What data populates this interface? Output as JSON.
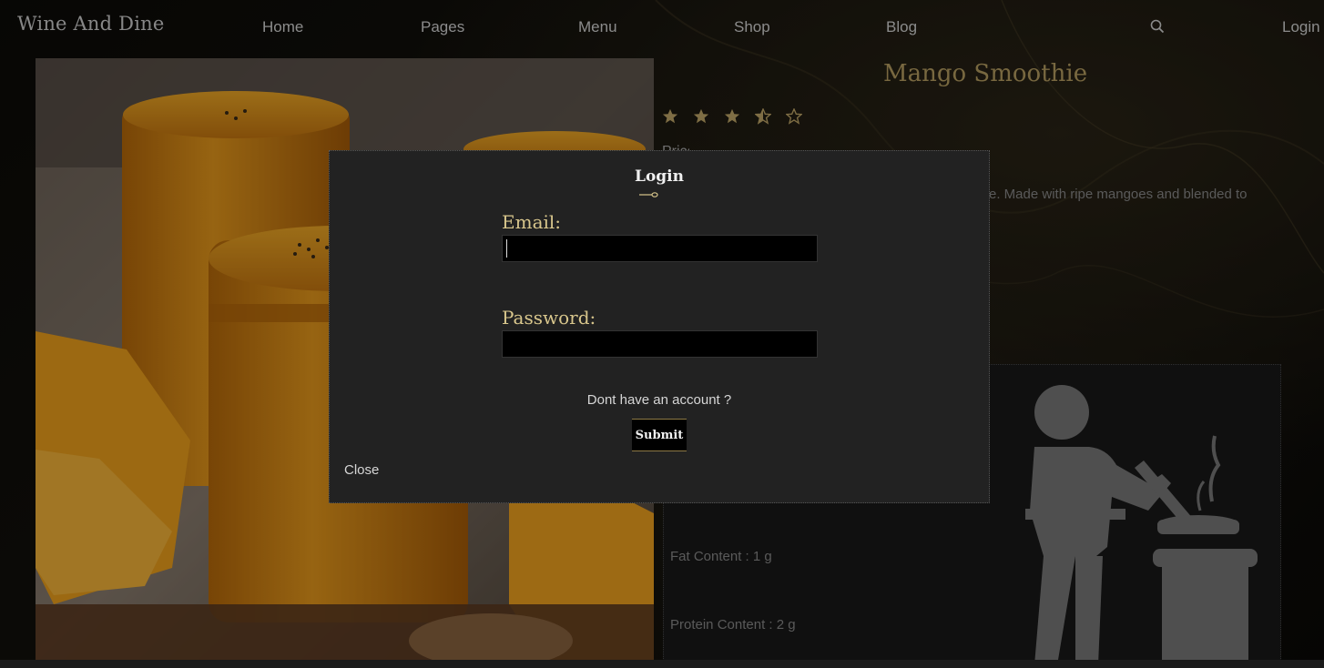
{
  "nav": {
    "brand": "Wine And Dine",
    "items": [
      "Home",
      "Pages",
      "Menu",
      "Shop",
      "Blog"
    ],
    "search_icon": "search-icon",
    "login": "Login"
  },
  "product": {
    "title": "Mango Smoothie",
    "rating": 3.5,
    "rating_max": 5,
    "description_partial": "e. Made with ripe mangoes and blended to",
    "price_partial": "Price"
  },
  "nutrition": {
    "fat": "Fat Content : 1 g",
    "protein": "Protein Content : 2 g",
    "illustration_icon": "chef-cooking-icon"
  },
  "login_modal": {
    "title": "Login",
    "email_label": "Email:",
    "email_value": "",
    "password_label": "Password:",
    "password_value": "",
    "signup_text": "Dont have an account ?",
    "submit_label": "Submit",
    "close_label": "Close"
  },
  "colors": {
    "accent_gold": "#b8a063",
    "label_gold": "#d8c68c",
    "modal_bg": "#222222"
  }
}
